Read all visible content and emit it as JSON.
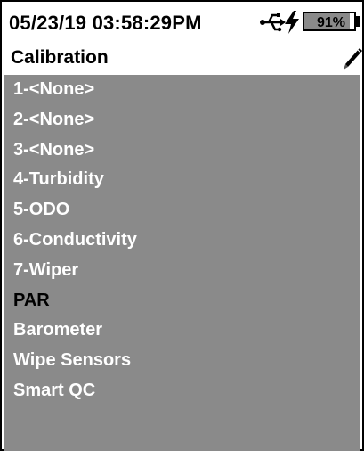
{
  "status_bar": {
    "date": "05/23/19",
    "time": "03:58:29PM",
    "battery_percent": "91%",
    "battery_level": 0.91,
    "icons": [
      "usb-icon",
      "charging-bolt-icon",
      "battery-icon"
    ]
  },
  "title_bar": {
    "title": "Calibration",
    "icon": "pencil-icon"
  },
  "menu": {
    "items": [
      {
        "label": "1-<None>",
        "style": "light"
      },
      {
        "label": "2-<None>",
        "style": "light"
      },
      {
        "label": "3-<None>",
        "style": "light"
      },
      {
        "label": "4-Turbidity",
        "style": "light"
      },
      {
        "label": "5-ODO",
        "style": "light"
      },
      {
        "label": "6-Conductivity",
        "style": "light"
      },
      {
        "label": "7-Wiper",
        "style": "light"
      },
      {
        "label": "PAR",
        "style": "dark"
      },
      {
        "label": "Barometer",
        "style": "light"
      },
      {
        "label": "Wipe Sensors",
        "style": "light"
      },
      {
        "label": "Smart QC",
        "style": "light"
      }
    ]
  },
  "colors": {
    "menu_background": "#8a8a8a",
    "menu_text": "#ffffff",
    "menu_text_dark": "#000000",
    "header_background": "#ffffff"
  }
}
